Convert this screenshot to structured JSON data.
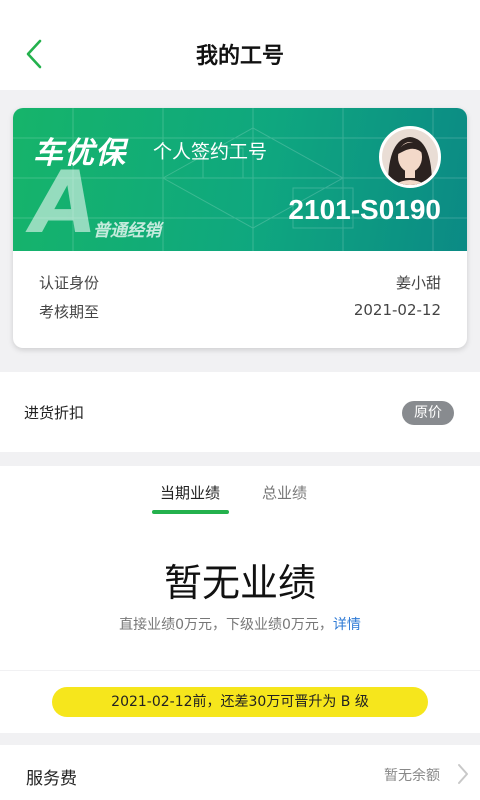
{
  "header": {
    "title": "我的工号",
    "back_icon": "chevron-left-icon"
  },
  "card": {
    "brand": "车优保",
    "subtitle": "个人签约工号",
    "level_letter": "A",
    "level_name": "普通经销",
    "number": "2101-S0190",
    "rows": [
      {
        "label": "认证身份",
        "value": "姜小甜"
      },
      {
        "label": "考核期至",
        "value": "2021-02-12"
      }
    ],
    "colors": {
      "gradient_start": "#16b46a",
      "gradient_end": "#0b8a85"
    }
  },
  "discount": {
    "label": "进货折扣",
    "badge": "原价"
  },
  "performance": {
    "tabs": [
      {
        "label": "当期业绩",
        "active": true
      },
      {
        "label": "总业绩",
        "active": false
      }
    ],
    "headline": "暂无业绩",
    "summary": "直接业绩0万元，下级业绩0万元，",
    "link": "详情"
  },
  "promo": {
    "text": "2021-02-12前，还差30万可晋升为 B 级"
  },
  "service_fee": {
    "label": "服务费",
    "value": "暂无余额"
  },
  "colors": {
    "accent": "#24b14d",
    "link": "#2f7bd6",
    "promo": "#f6e61c"
  }
}
